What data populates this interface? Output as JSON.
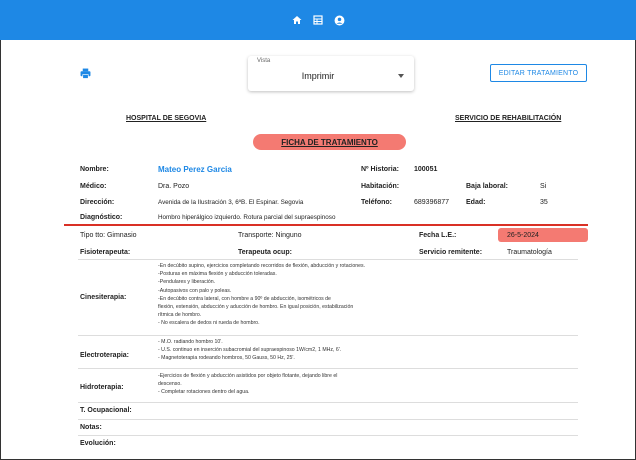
{
  "nav": {
    "icons": [
      "home-icon",
      "grid-icon",
      "user-icon"
    ]
  },
  "toolbar": {
    "vista_label": "Vista",
    "vista_value": "Imprimir",
    "edit_label": "EDITAR TRATAMIENTO"
  },
  "header": {
    "hospital": "HOSPITAL DE SEGOVIA",
    "service": "SERVICIO DE REHABILITACIÓN",
    "title": "FICHA DE TRATAMIENTO"
  },
  "patient": {
    "nombre_label": "Nombre:",
    "nombre": "Mateo Perez Garcia",
    "historia_label": "Nº Historia:",
    "historia": "100051",
    "medico_label": "Médico:",
    "medico": "Dra. Pozo",
    "habitacion_label": "Habitación:",
    "baja_label": "Baja laboral:",
    "baja": "Si",
    "direccion_label": "Dirección:",
    "direccion": "Avenida de la Ilustración 3, 6ºB. El Espinar. Segovia",
    "telefono_label": "Teléfono:",
    "telefono": "689396877",
    "edad_label": "Edad:",
    "edad": "35",
    "diagnostico_label": "Diagnóstico:",
    "diagnostico": "Hombro hiperálgico izquierdo. Rotura parcial del supraespinoso"
  },
  "treatment": {
    "tipo": "Tipo tto: Gimnasio",
    "transporte": "Transporte: Ninguno",
    "fecha_label": "Fecha L.E.:",
    "fecha": "26-5-2024",
    "fisio_label": "Fisioterapeuta:",
    "terapeuta_label": "Terapeuta ocup:",
    "remitente_label": "Servicio remitente:",
    "remitente": "Traumatología",
    "cinesi_label": "Cinesiterapia:",
    "cinesi_lines": [
      "-En decúbito supino, ejercicios completando recorridos de flexión, abducción y rotaciones.",
      "-Posturas en máxima flexión y abducción toleradas.",
      "-Pendulares y liberación.",
      "-Autopasivos con palo y poleas.",
      "-En decúbito contra lateral, con hombre a 90º de abducción, isométricos de",
      "flexión, extensión, abducción y aducción de hombro. En igual posición, estabilización",
      "rítmica de hombro.",
      "- No escalera de dedos ni rueda de hombro."
    ],
    "electro_label": "Electroterapia:",
    "electro_lines": [
      "- M.O. radiando hombro 10'.",
      "- U.S. continuo en inserción subacromial del supraespinoso 1W/cm2, 1 MHz, 6'.",
      "- Magnetoterapia rodeando hombros, 50 Gauss, 50 Hz, 25'."
    ],
    "hidro_label": "Hidroterapia:",
    "hidro_lines": [
      "-Ejercicios de flexión y abducción asistidos por objeto flotante, dejando libre el",
      "descenso.",
      "- Completar rotaciones dentro del agua."
    ],
    "ocupacional_label": "T. Ocupacional:",
    "notas_label": "Notas:",
    "evolucion_label": "Evolución:"
  },
  "colors": {
    "primary": "#1e88e5",
    "accent": "#f47a72",
    "divider": "#d93025"
  }
}
